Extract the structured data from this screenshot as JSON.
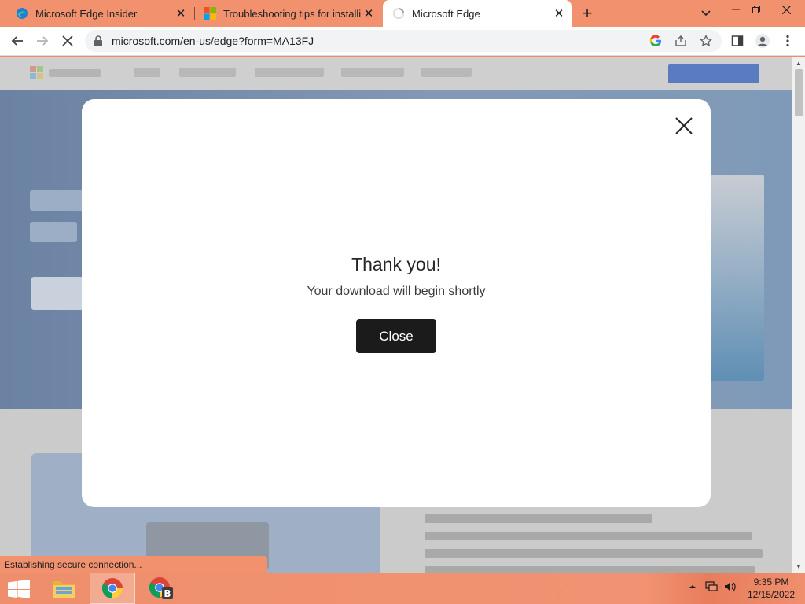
{
  "tabs": [
    {
      "title": "Microsoft Edge Insider",
      "icon": "edge-icon",
      "active": false
    },
    {
      "title": "Troubleshooting tips for installing",
      "icon": "microsoft-logo-icon",
      "active": false
    },
    {
      "title": "Microsoft Edge",
      "icon": "loading-spinner-icon",
      "active": true
    }
  ],
  "toolbar": {
    "url": "microsoft.com/en-us/edge?form=MA13FJ"
  },
  "modal": {
    "heading": "Thank you!",
    "message": "Your download will begin shortly",
    "close_button": "Close"
  },
  "status_bar": "Establishing secure connection...",
  "taskbar": {
    "apps": [
      {
        "name": "file-explorer-icon"
      },
      {
        "name": "chrome-icon",
        "active": true
      },
      {
        "name": "chrome-profile-b-icon",
        "badge": "B"
      }
    ],
    "time": "9:35 PM",
    "date": "12/15/2022"
  },
  "colors": {
    "frame_accent": "#f1916e",
    "modal_button": "#1b1b1b",
    "page_overlay": "#c9c9c9"
  }
}
